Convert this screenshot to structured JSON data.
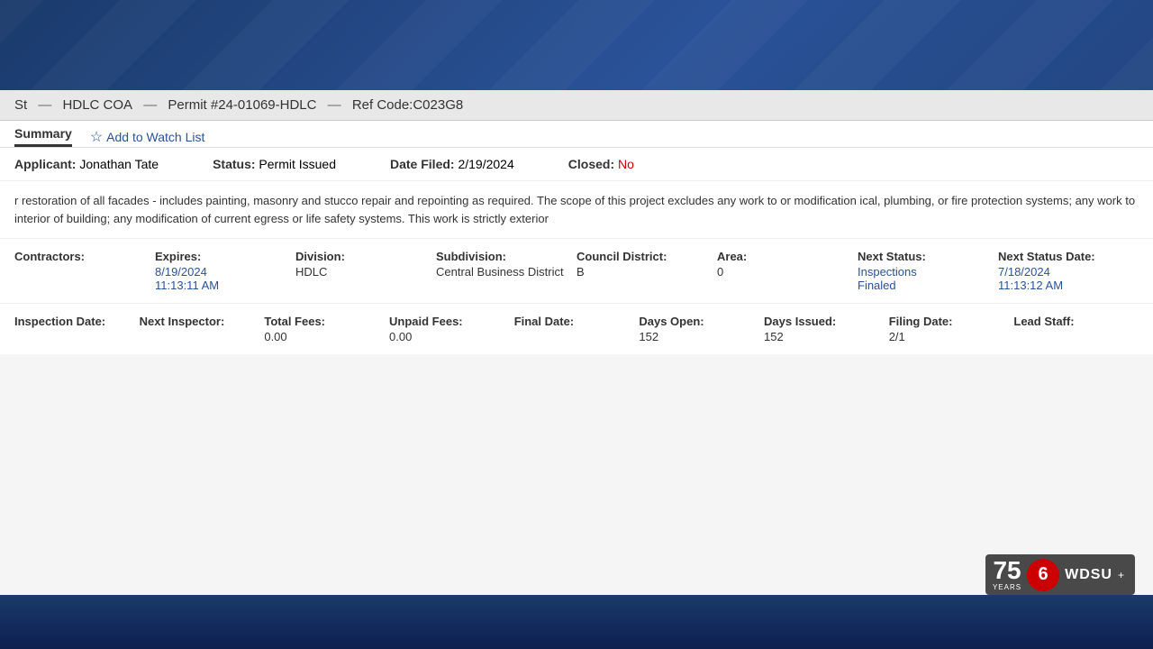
{
  "background": {
    "color": "#1a3a6b"
  },
  "breadcrumb": {
    "parts": [
      "St",
      "HDLC COA",
      "Permit #24-01069-HDLC",
      "Ref Code:C023G8"
    ]
  },
  "tabs": {
    "active": "Summary",
    "watchlist_label": "Add to Watch List"
  },
  "info_row": {
    "applicant_label": "Applicant:",
    "applicant_value": "Jonathan Tate",
    "status_label": "Status:",
    "status_value": "Permit Issued",
    "date_filed_label": "Date Filed:",
    "date_filed_value": "2/19/2024",
    "closed_label": "Closed:",
    "closed_value": "No"
  },
  "description": {
    "text": "r restoration of all facades - includes painting, masonry and stucco repair and repointing as required. The scope of this project excludes any work to or modification ical, plumbing, or fire protection systems; any work to interior of building; any modification of current egress or life safety systems. This work is strictly exterior"
  },
  "details": {
    "contractors_label": "Contractors:",
    "contractors_value": "",
    "expires_label": "Expires:",
    "expires_date": "8/19/2024",
    "expires_time": "11:13:11 AM",
    "division_label": "Division:",
    "division_value": "HDLC",
    "subdivision_label": "Subdivision:",
    "subdivision_value": "Central Business District",
    "council_label": "Council District:",
    "council_value": "B",
    "area_label": "Area:",
    "area_value": "0",
    "next_status_label": "Next Status:",
    "next_status_value": "Inspections Finaled",
    "next_status_date_label": "Next Status Date:",
    "next_status_date": "7/18/2024",
    "next_status_time": "11:13:12 AM"
  },
  "stats": {
    "inspection_date_label": "Inspection Date:",
    "inspection_date_value": "",
    "next_inspector_label": "Next Inspector:",
    "next_inspector_value": "",
    "total_fees_label": "Total Fees:",
    "total_fees_value": "0.00",
    "unpaid_fees_label": "Unpaid Fees:",
    "unpaid_fees_value": "0.00",
    "final_date_label": "Final Date:",
    "final_date_value": "",
    "days_open_label": "Days Open:",
    "days_open_value": "152",
    "days_issued_label": "Days Issued:",
    "days_issued_value": "152",
    "filing_date_label": "Filing Date:",
    "filing_date_value": "2/1",
    "lead_staff_label": "Lead Staff:",
    "lead_staff_value": ""
  },
  "wdsu": {
    "years": "75",
    "years_label": "YEARS",
    "channel": "6",
    "name": "WDSU",
    "plus_symbol": "+"
  }
}
